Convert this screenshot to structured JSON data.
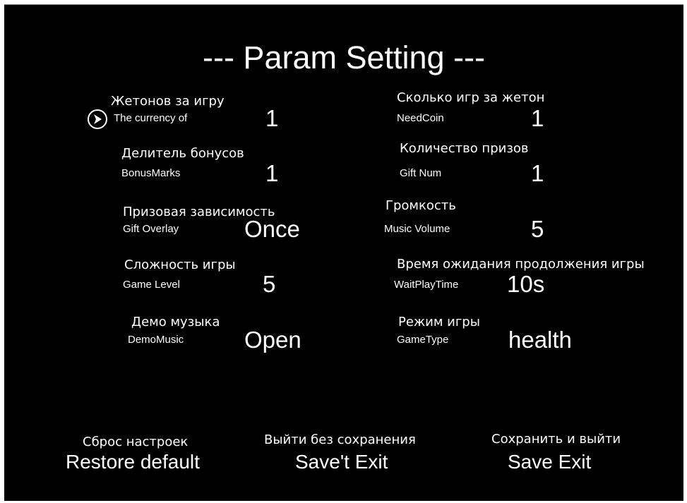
{
  "title": "--- Param Setting ---",
  "params": [
    {
      "ru": "Жетонов за игру",
      "en": "The currency of",
      "value": "1"
    },
    {
      "ru": "Сколько игр за жетон",
      "en": "NeedCoin",
      "value": "1"
    },
    {
      "ru": "Делитель бонусов",
      "en": "BonusMarks",
      "value": "1"
    },
    {
      "ru": "Количество призов",
      "en": "Gift Num",
      "value": "1"
    },
    {
      "ru": "Призовая зависимость",
      "en": "Gift Overlay",
      "value": "Once"
    },
    {
      "ru": "Громкость",
      "en": "Music Volume",
      "value": "5"
    },
    {
      "ru": "Сложность игры",
      "en": "Game Level",
      "value": "5"
    },
    {
      "ru": "Время ожидания продолжения игры",
      "en": "WaitPlayTime",
      "value": "10s"
    },
    {
      "ru": "Демо музыка",
      "en": "DemoMusic",
      "value": "Open"
    },
    {
      "ru": "Режим игры",
      "en": "GameType",
      "value": "health"
    }
  ],
  "buttons": {
    "restore": {
      "ru": "Сброс настроек",
      "en": "Restore default"
    },
    "exit_no_save": {
      "ru": "Выйти без сохранения",
      "en": "Save't Exit"
    },
    "save_exit": {
      "ru": "Сохранить и выйти",
      "en": "Save Exit"
    }
  },
  "cursor_icon": "chevron-right-circle-icon"
}
